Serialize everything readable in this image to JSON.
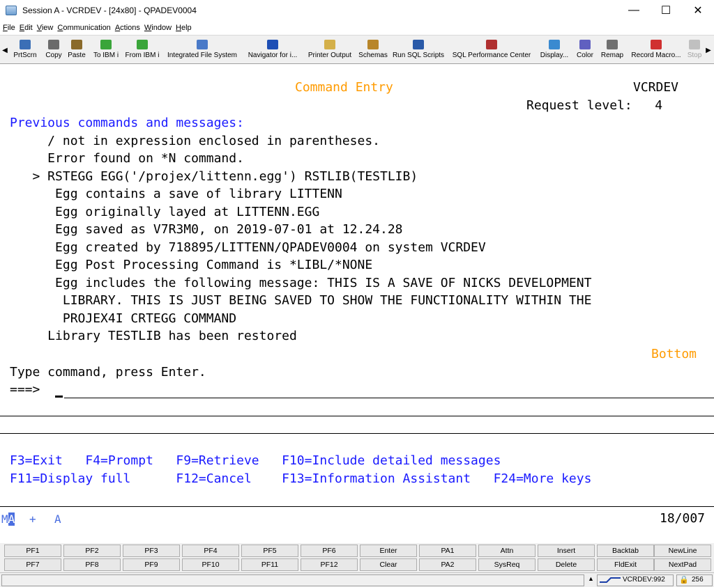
{
  "window": {
    "title": "Session A - VCRDEV - [24x80] - QPADEV0004",
    "minimize": "—",
    "maximize": "☐",
    "close": "✕"
  },
  "menu": [
    "File",
    "Edit",
    "View",
    "Communication",
    "Actions",
    "Window",
    "Help"
  ],
  "toolbar": [
    {
      "label": "PrtScrn",
      "icon": "print-screen-icon",
      "color": "#3b6fb6"
    },
    {
      "label": "Copy",
      "icon": "copy-icon",
      "color": "#6b6b6b"
    },
    {
      "label": "Paste",
      "icon": "paste-icon",
      "color": "#8a6a2a"
    },
    {
      "label": "To IBM i",
      "icon": "upload-arrow-icon",
      "color": "#3aa53a"
    },
    {
      "label": "From IBM i",
      "icon": "download-arrow-icon",
      "color": "#3aa53a"
    },
    {
      "label": "Integrated File System",
      "icon": "file-system-icon",
      "color": "#4a7ac8"
    },
    {
      "label": "Navigator for i...",
      "icon": "compass-icon",
      "color": "#1e4fb5"
    },
    {
      "label": "Printer Output",
      "icon": "printer-output-icon",
      "color": "#d4b04a"
    },
    {
      "label": "Schemas",
      "icon": "schemas-icon",
      "color": "#b8862a"
    },
    {
      "label": "Run SQL Scripts",
      "icon": "sql-scripts-icon",
      "color": "#2a5aa8"
    },
    {
      "label": "SQL Performance Center",
      "icon": "performance-center-icon",
      "color": "#b03030"
    },
    {
      "label": "Display...",
      "icon": "display-icon",
      "color": "#3a8ad0"
    },
    {
      "label": "Color",
      "icon": "color-palette-icon",
      "color": "#6060c0"
    },
    {
      "label": "Remap",
      "icon": "remap-icon",
      "color": "#707070"
    },
    {
      "label": "Record Macro...",
      "icon": "record-macro-icon",
      "color": "#d03030"
    },
    {
      "label": "Stop",
      "icon": "stop-icon",
      "color": "#c0c0c0"
    }
  ],
  "terminal": {
    "screen_title": "Command Entry",
    "system_name": "VCRDEV",
    "request_level": "Request level:   4",
    "section_header": "Previous commands and messages:",
    "messages": [
      "     / not in expression enclosed in parentheses.",
      "     Error found on *N command.",
      "   > RSTEGG EGG('/projex/littenn.egg') RSTLIB(TESTLIB)",
      "      Egg contains a save of library LITTENN",
      "      Egg originally layed at LITTENN.EGG",
      "      Egg saved as V7R3M0, on 2019-07-01 at 12.24.28",
      "      Egg created by 718895/LITTENN/QPADEV0004 on system VCRDEV",
      "      Egg Post Processing Command is *LIBL/*NONE",
      "      Egg includes the following message: THIS IS A SAVE OF NICKS DEVELOPMENT",
      "       LIBRARY. THIS IS JUST BEING SAVED TO SHOW THE FUNCTIONALITY WITHIN THE",
      "       PROJEX4I CRTEGG COMMAND",
      "     Library TESTLIB has been restored"
    ],
    "more_indicator": "Bottom",
    "prompt_text": "Type command, press Enter.",
    "prompt_arrow": "===>",
    "command_value": "",
    "fkeys_row1": "F3=Exit   F4=Prompt   F9=Retrieve   F10=Include detailed messages",
    "fkeys_row2": "F11=Display full      F12=Cancel    F13=Information Assistant   F24=More keys"
  },
  "oia": {
    "mode": "MA",
    "mode_highlight": "A",
    "insert_indicator": "+",
    "input_indicator": "A",
    "cursor_position": "18/007"
  },
  "keypad": {
    "row1": [
      "PF1",
      "PF2",
      "PF3",
      "PF4",
      "PF5",
      "PF6",
      "Enter",
      "PA1",
      "Attn",
      "Insert",
      "Backtab",
      "NewLine"
    ],
    "row2": [
      "PF7",
      "PF8",
      "PF9",
      "PF10",
      "PF11",
      "PF12",
      "Clear",
      "PA2",
      "SysReq",
      "Delete",
      "FldExit",
      "NextPad"
    ]
  },
  "statusbar": {
    "connection": "VCRDEV:992",
    "lock_count": "256"
  },
  "colors": {
    "terminal_blue": "#1a1aff",
    "terminal_orange": "#ff9b00",
    "toolbar_bg": "#f0f0f0"
  }
}
